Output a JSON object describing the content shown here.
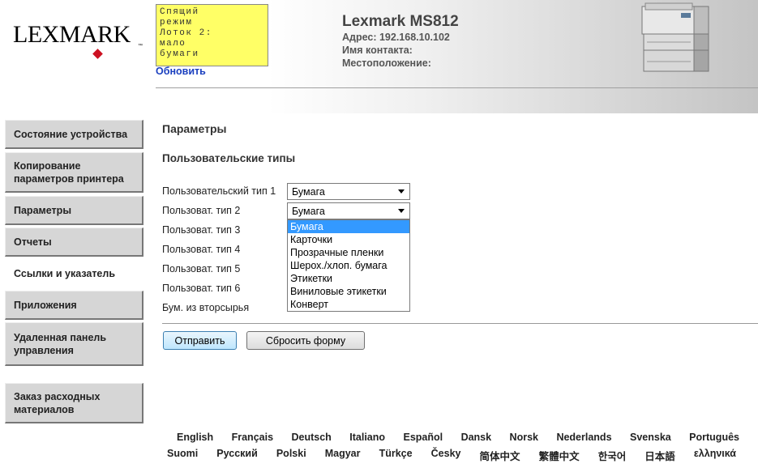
{
  "header": {
    "logo_text": "LEXMARK",
    "status_panel": "Спящий\nрежим\nЛоток 2:\nмало\nбумаги",
    "refresh_link": "Обновить",
    "printer_title": "Lexmark MS812",
    "address": "Адрес: 192.168.10.102",
    "contact": "Имя контакта:",
    "location": "Местоположение:"
  },
  "sidebar": {
    "items": [
      {
        "label": "Состояние устройства"
      },
      {
        "label": "Копирование параметров принтера"
      },
      {
        "label": "Параметры"
      },
      {
        "label": "Отчеты"
      },
      {
        "label": "Ссылки и указатель"
      },
      {
        "label": "Приложения"
      },
      {
        "label": "Удаленная панель управления"
      },
      {
        "label": "Заказ расходных материалов"
      }
    ]
  },
  "main": {
    "section_title": "Параметры",
    "subsection_title": "Пользовательские типы",
    "fields": [
      {
        "label": "Пользовательский тип 1",
        "value": "Бумага"
      },
      {
        "label": "Пользоват. тип 2",
        "value": "Бумага"
      },
      {
        "label": "Пользоват. тип 3"
      },
      {
        "label": "Пользоват. тип 4"
      },
      {
        "label": "Пользоват. тип 5"
      },
      {
        "label": "Пользоват. тип 6"
      },
      {
        "label": "Бум. из вторсырья"
      }
    ],
    "dropdown_options": [
      "Бумага",
      "Карточки",
      "Прозрачные пленки",
      "Шерох./хлоп. бумага",
      "Этикетки",
      "Виниловые этикетки",
      "Конверт"
    ],
    "dropdown_selected": "Бумага",
    "submit_label": "Отправить",
    "reset_label": "Сбросить форму"
  },
  "languages": {
    "row1": [
      "English",
      "Français",
      "Deutsch",
      "Italiano",
      "Español",
      "Dansk",
      "Norsk",
      "Nederlands",
      "Svenska",
      "Português"
    ],
    "row2": [
      "Suomi",
      "Русский",
      "Polski",
      "Magyar",
      "Türkçe",
      "Česky",
      "简体中文",
      "繁體中文",
      "한국어",
      "日本語",
      "ελληνικά"
    ]
  },
  "colors": {
    "status_panel_bg": "#ffff66",
    "link": "#1a3fbf",
    "dropdown_highlight": "#3399ff",
    "logo_diamond": "#cc1122"
  },
  "icons": [
    "printer-image",
    "dropdown-arrow-icon",
    "logo-diamond"
  ]
}
